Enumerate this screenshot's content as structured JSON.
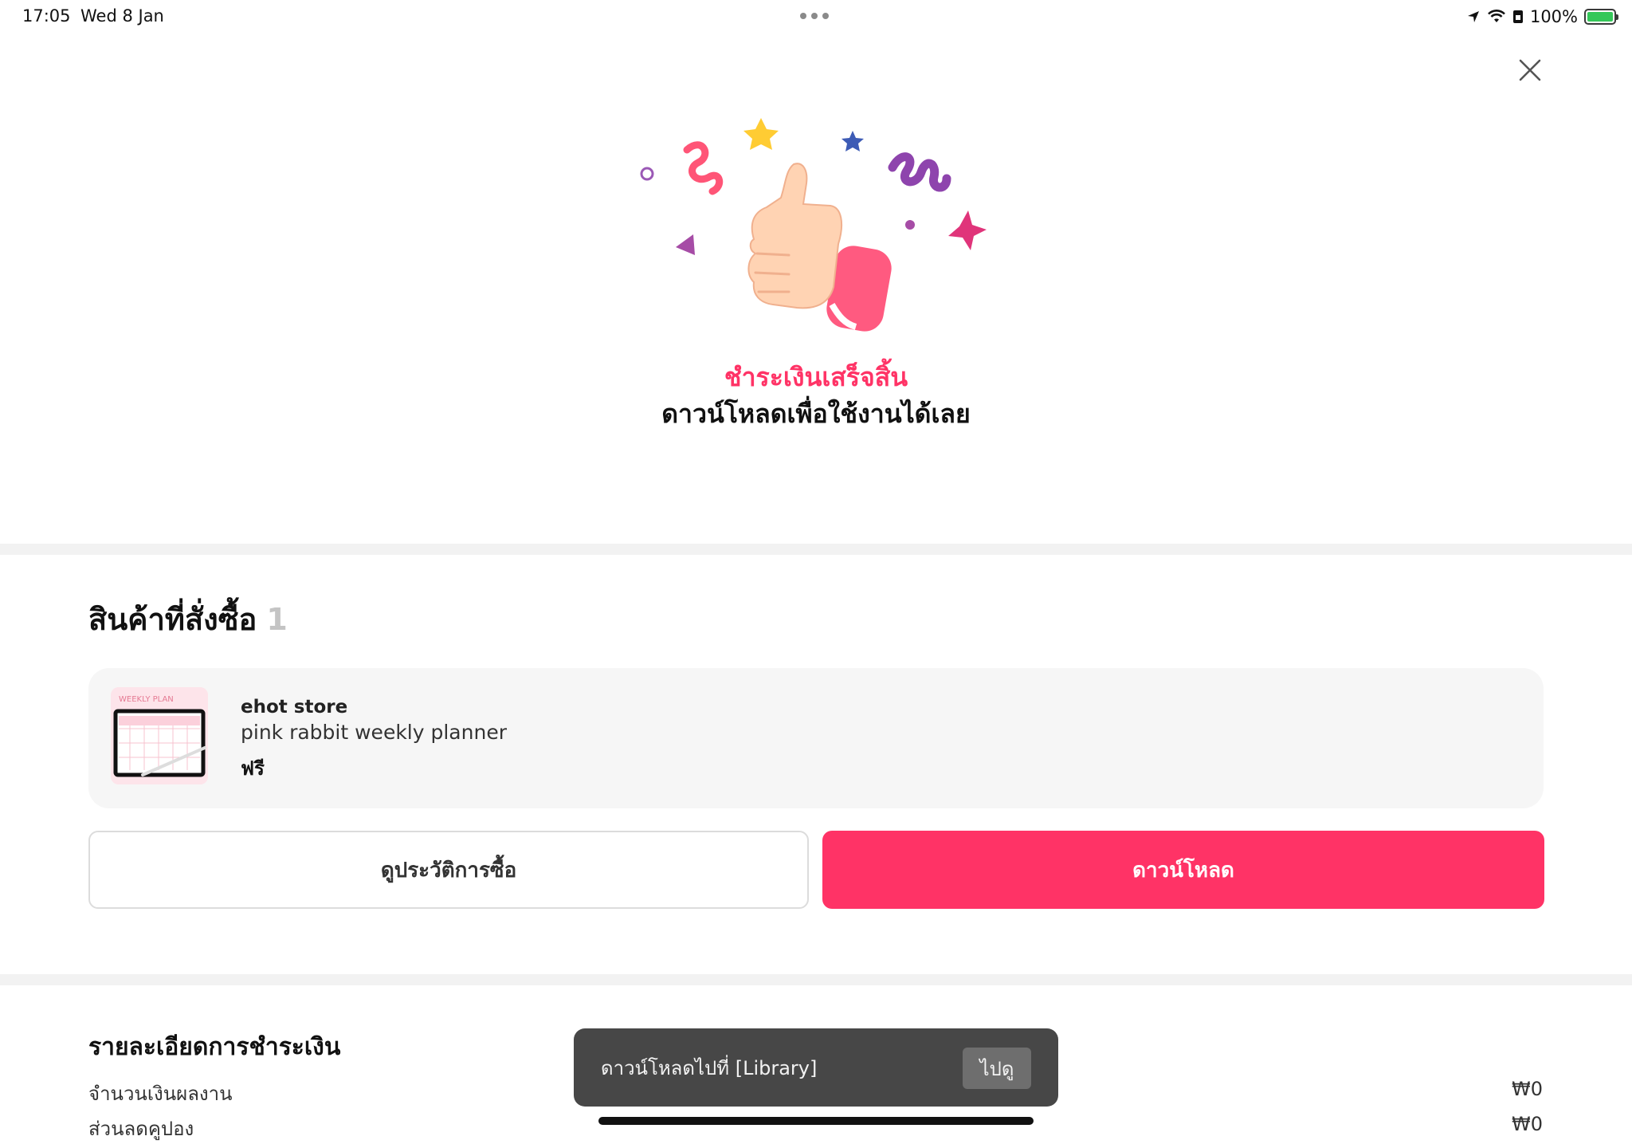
{
  "status_bar": {
    "time": "17:05",
    "date": "Wed 8 Jan",
    "battery_percent": "100%",
    "battery_level": 1.0,
    "icons": [
      "location-arrow-icon",
      "wifi-icon",
      "lock-rotation-icon",
      "battery-charging-icon"
    ]
  },
  "header": {
    "close_icon": "close-icon"
  },
  "success": {
    "title": "ชำระเงินเสร็จสิ้น",
    "subtitle": "ดาวน์โหลดเพื่อใช้งานได้เลย",
    "illustration": "thumbs-up-confetti-icon"
  },
  "ordered": {
    "title": "สินค้าที่สั่งซื้อ",
    "count": "1",
    "items": [
      {
        "store": "ehot store",
        "name": "pink rabbit weekly planner",
        "price": "ฟรี",
        "thumbnail_text": "WEEKLY PLAN"
      }
    ]
  },
  "actions": {
    "history_label": "ดูประวัติการซื้อ",
    "download_label": "ดาวน์โหลด"
  },
  "payment": {
    "title": "รายละเอียดการชำระเงิน",
    "rows": [
      {
        "label": "จำนวนเงินผลงาน",
        "value": "₩0"
      },
      {
        "label": "ส่วนลดคูปอง",
        "value": "₩0"
      }
    ]
  },
  "toast": {
    "message": "ดาวน์โหลดไปที่ [Library]",
    "button_label": "ไปดู"
  },
  "colors": {
    "accent": "#ff3366",
    "toast_bg": "#474747",
    "card_bg": "#f6f6f6",
    "divider": "#f2f2f2"
  }
}
